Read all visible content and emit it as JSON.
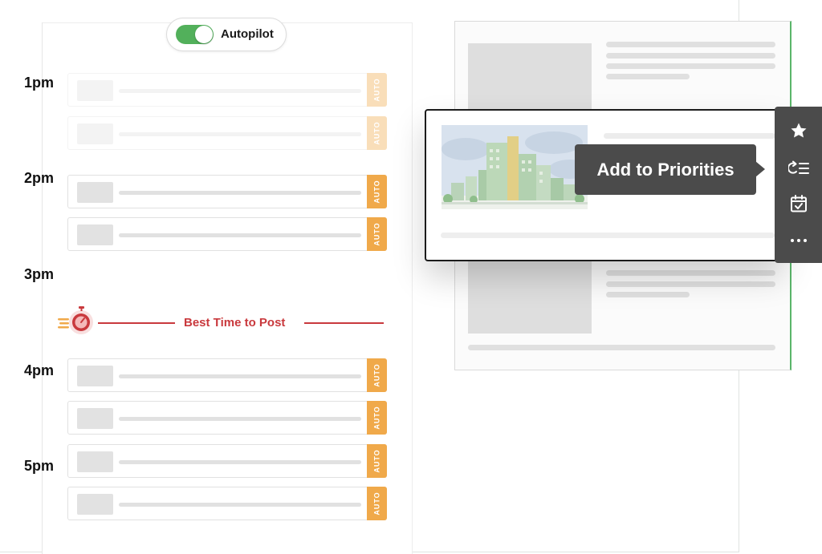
{
  "autopilot": {
    "label": "Autopilot",
    "enabled": true
  },
  "schedule": {
    "hours": [
      {
        "label": "1pm"
      },
      {
        "label": "2pm"
      },
      {
        "label": "3pm"
      },
      {
        "label": "4pm"
      },
      {
        "label": "5pm"
      }
    ],
    "auto_badge": "AUTO",
    "best_time_label": "Best Time to Post"
  },
  "popup": {
    "tooltip": "Add to Priorities"
  },
  "toolbar": {
    "icons": [
      "star-icon",
      "add-to-priorities-icon",
      "calendar-check-icon",
      "more-icon"
    ]
  },
  "colors": {
    "toggle_on": "#52b05b",
    "auto_badge": "#f0a94a",
    "best_time": "#c9393d",
    "tooltip_bg": "#4b4b4b"
  }
}
